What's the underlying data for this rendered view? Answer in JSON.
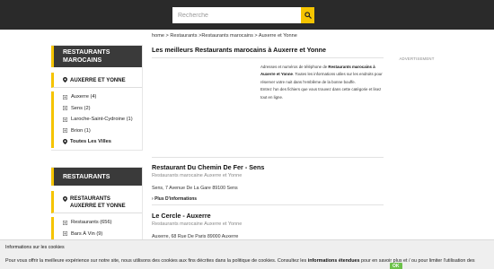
{
  "colors": {
    "topbar": "#2a2a2a",
    "accent": "#f5c400",
    "cookie_ok": "#6cc24a"
  },
  "search": {
    "placeholder": "Recherche",
    "button_icon": "search-icon"
  },
  "breadcrumb": "home > Restaurants >Restaurants marocains > Auxerre et Yonne",
  "page_title": "Les meilleurs Restaurants marocains à Auxerre et Yonne",
  "ad_label": "ADVERTISEMENT",
  "intro": {
    "p1_before": "Adresses et numéros de téléphone de ",
    "p1_bold": "Restaurants marocains à Auxerre et Yonne",
    "p1_after": ". Toutes les informations utiles sur les endroits pour réserver votre nuit dans l'emblème de la bonne bouffe.",
    "p2": "Entrez l'un des fichiers que vous trouvez dans cette catégorie et lisez tout en ligne."
  },
  "sidebar1": {
    "heading": "RESTAURANTS MAROCAINS",
    "location": "AUXERRE ET YONNE",
    "items": [
      {
        "label": "Auxerre (4)"
      },
      {
        "label": "Sens (2)"
      },
      {
        "label": "Laroche-Saint-Cydroine (1)"
      },
      {
        "label": "Brion (1)"
      }
    ],
    "all_label": "Toutes Les Villes"
  },
  "sidebar2": {
    "heading": "RESTAURANTS",
    "location": "RESTAURANTS AUXERRE ET YONNE",
    "items": [
      {
        "label": "Restaurants (656)"
      },
      {
        "label": "Bars À Vin (9)"
      }
    ]
  },
  "listings": [
    {
      "name": "Restaurant Du Chemin De Fer - Sens",
      "category": "Restaurants marocaine Auxerre et Yonne",
      "address": "Sens, 7 Avenue De La Gare 89100 Sens",
      "more": "Plus D'informations"
    },
    {
      "name": "Le Cercle - Auxerre",
      "category": "Restaurants marocaine Auxerre et Yonne",
      "address": "Auxerre, 68 Rue De Paris 89000 Auxerre"
    }
  ],
  "cookie": {
    "title": "Informations sur les cookies",
    "text_before": "Pour vous offrir la meilleure expérience sur notre site, nous utilisons des cookies aux fins décrites dans la politique de cookies. Consultez les ",
    "text_bold": "informations étendues",
    "text_middle": " pour en savoir plus et / ou pour limiter l'utilisation des",
    "ok_label": "OK"
  }
}
